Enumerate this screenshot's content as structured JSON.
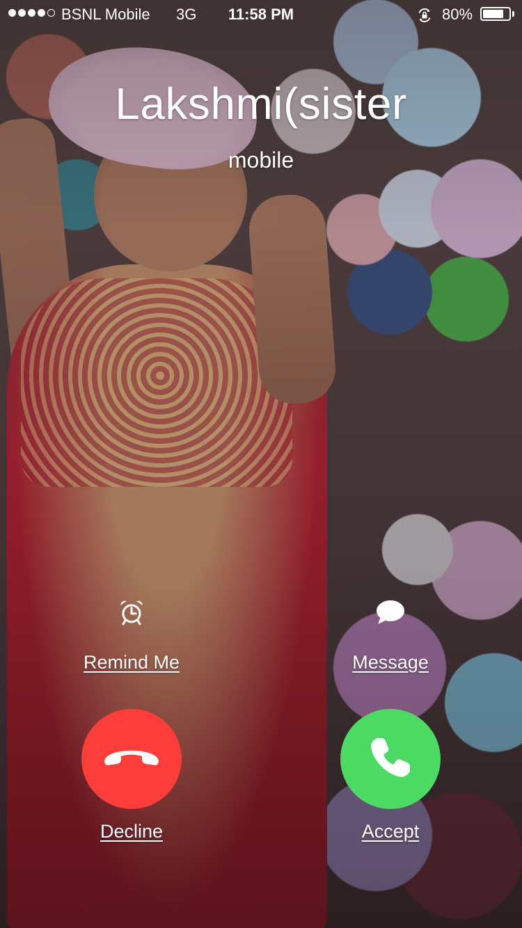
{
  "status_bar": {
    "signal_dots_filled": 4,
    "signal_dots_total": 5,
    "carrier": "BSNL Mobile",
    "network": "3G",
    "time": "11:58 PM",
    "battery_text": "80%",
    "battery_level": 0.8,
    "icons": [
      "rotation-lock-icon",
      "battery-icon"
    ]
  },
  "caller": {
    "name": "Lakshmi(sister",
    "label": "mobile"
  },
  "actions": {
    "remind": {
      "label": "Remind Me",
      "icon": "alarm-clock-icon"
    },
    "message": {
      "label": "Message",
      "icon": "speech-bubble-icon"
    }
  },
  "call_buttons": {
    "decline": {
      "label": "Decline",
      "icon": "phone-hangup-icon",
      "color": "#fc3d39"
    },
    "accept": {
      "label": "Accept",
      "icon": "phone-icon",
      "color": "#4cd964"
    }
  },
  "background": {
    "description_icon": "contact-photo"
  }
}
